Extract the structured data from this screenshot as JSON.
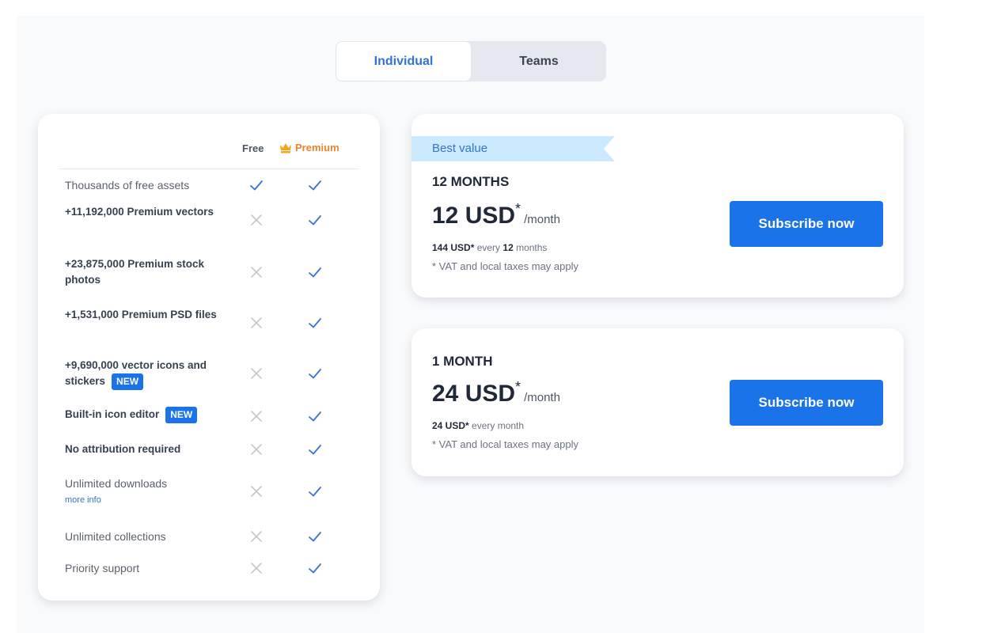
{
  "toggle": {
    "options": [
      {
        "label": "Individual",
        "active": true
      },
      {
        "label": "Teams",
        "active": false
      }
    ]
  },
  "features": {
    "columns": {
      "free": "Free",
      "premium": "Premium",
      "premium_icon": "crown-icon"
    },
    "rows": [
      {
        "label": "Thousands of free assets",
        "bold": false,
        "free": true,
        "premium": true
      },
      {
        "label": "+11,192,000 Premium vectors",
        "bold": true,
        "free": false,
        "premium": true
      },
      {
        "label": "+23,875,000 Premium stock photos",
        "bold": true,
        "free": false,
        "premium": true
      },
      {
        "label": "+1,531,000 Premium PSD files",
        "bold": true,
        "free": false,
        "premium": true
      },
      {
        "label": "+9,690,000 vector icons and stickers",
        "bold": true,
        "badge": "NEW",
        "free": false,
        "premium": true
      },
      {
        "label": "Built-in icon editor",
        "bold": true,
        "badge": "NEW",
        "free": false,
        "premium": true
      },
      {
        "label": "No attribution required",
        "bold": true,
        "free": false,
        "premium": true
      },
      {
        "label": "Unlimited downloads",
        "bold": false,
        "link": "more info",
        "free": false,
        "premium": true
      },
      {
        "label": "Unlimited collections",
        "bold": false,
        "free": false,
        "premium": true
      },
      {
        "label": "Priority support",
        "bold": false,
        "free": false,
        "premium": true
      }
    ],
    "colors": {
      "check": "#3a6fd0",
      "cross": "#c4c7cc",
      "premium": "#e8842c"
    }
  },
  "plans": [
    {
      "ribbon": "Best value",
      "title": "12 MONTHS",
      "price": "12 USD",
      "asterisk": "*",
      "period": "/month",
      "total_amount": "144 USD*",
      "total_text_1": " every ",
      "total_bold_2": "12",
      "total_text_2": " months",
      "vat": "* VAT and local taxes may apply",
      "button": "Subscribe now"
    },
    {
      "title": "1 MONTH",
      "price": "24 USD",
      "asterisk": "*",
      "period": "/month",
      "total_amount": "24 USD*",
      "total_text_1": " every month",
      "vat": "* VAT and local taxes may apply",
      "button": "Subscribe now"
    }
  ],
  "brand_color": "#1a73e8"
}
